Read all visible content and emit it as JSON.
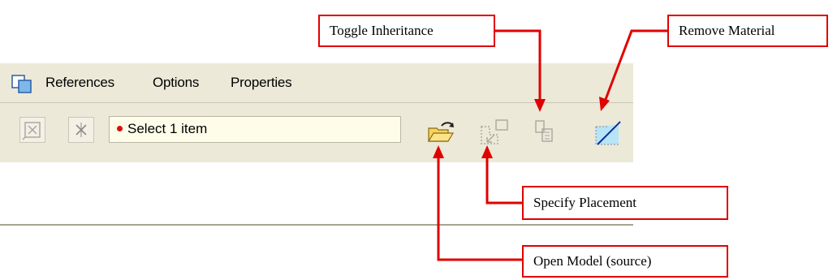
{
  "menubar": {
    "app_icon": "feature-dashboard-icon",
    "items": [
      {
        "label": "References"
      },
      {
        "label": "Options"
      },
      {
        "label": "Properties"
      }
    ]
  },
  "toolbar": {
    "buttons": [
      {
        "icon": "collector-icon-1"
      },
      {
        "icon": "collector-icon-2"
      }
    ],
    "selector": {
      "status_color": "#d4110b",
      "text": "Select 1 item"
    },
    "icons": [
      {
        "icon": "open-folder-icon"
      },
      {
        "icon": "specify-placement-icon"
      },
      {
        "icon": "toggle-inheritance-icon"
      },
      {
        "icon": "remove-material-icon"
      }
    ]
  },
  "callouts": {
    "toggle_inheritance": "Toggle Inheritance",
    "remove_material": "Remove Material",
    "specify_placement": "Specify Placement",
    "open_model": "Open Model (source)",
    "leader_color": "#e00000"
  }
}
